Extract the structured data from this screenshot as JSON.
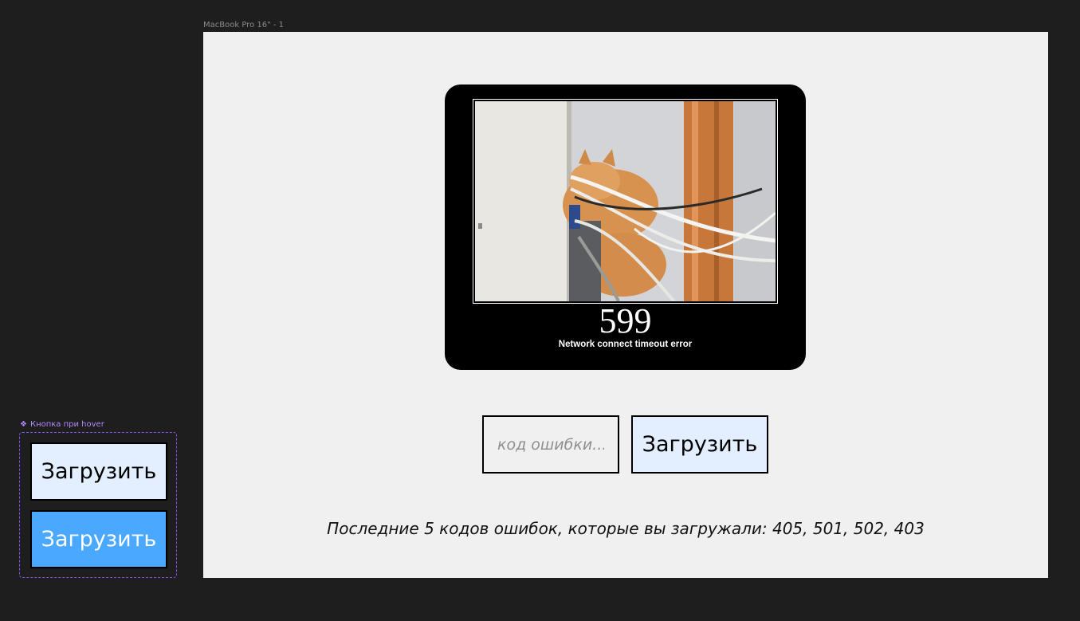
{
  "frame": {
    "label": "MacBook Pro 16\" - 1"
  },
  "poster": {
    "code": "599",
    "caption": "Network connect timeout error",
    "image_description": "cat-tangled-in-cables-photo"
  },
  "search": {
    "placeholder": "код ошибки...",
    "value": "",
    "button_label": "Загрузить"
  },
  "history": {
    "text": "Последние 5 кодов ошибок, которые вы загружали: 405, 501, 502, 403"
  },
  "component": {
    "label": "Кнопка при hover",
    "icon": "component-icon",
    "variants": [
      {
        "state": "default",
        "label": "Загрузить",
        "background": "#e3efff"
      },
      {
        "state": "hover",
        "label": "Загрузить",
        "background": "#4aa8ff"
      }
    ]
  },
  "colors": {
    "canvas": "#1e1e1e",
    "frame": "#f0f0f0",
    "button": "#e3efff",
    "button_hover": "#4aa8ff",
    "component_accent": "#8a4fff"
  }
}
